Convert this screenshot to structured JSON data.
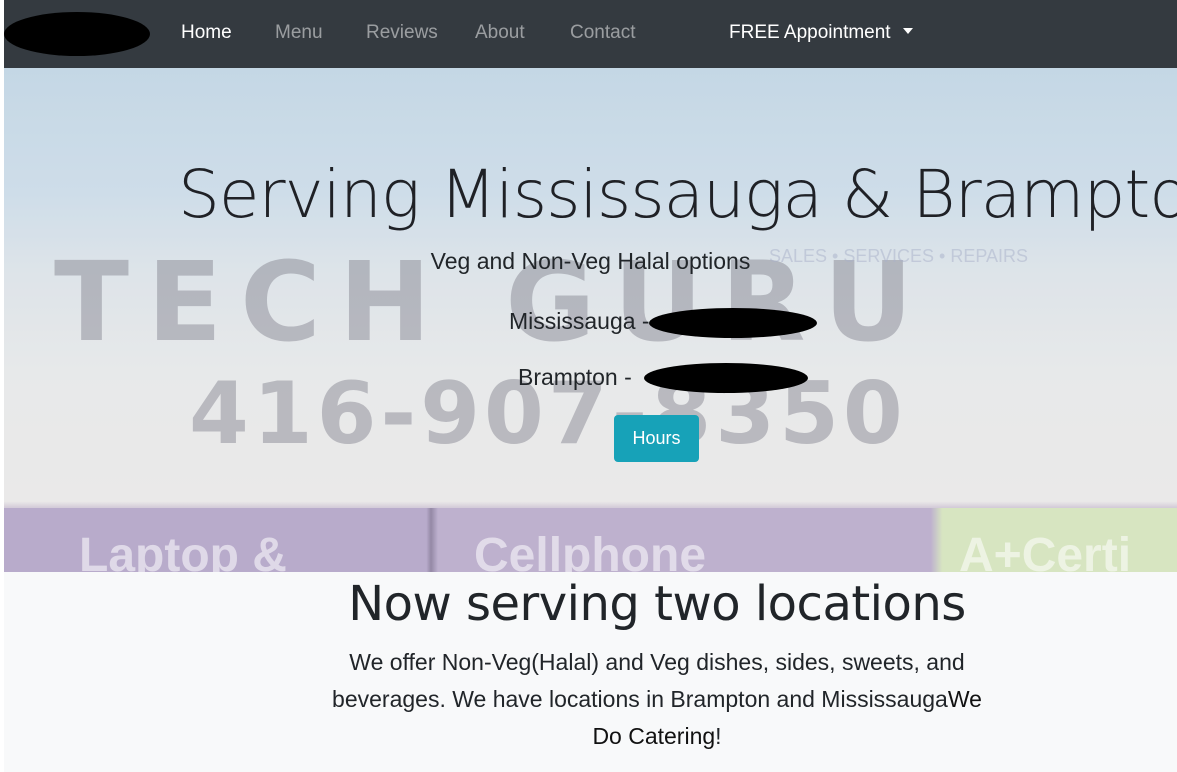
{
  "nav": {
    "items": [
      {
        "label": "Home",
        "active": true
      },
      {
        "label": "Menu",
        "active": false
      },
      {
        "label": "Reviews",
        "active": false
      },
      {
        "label": "About",
        "active": false
      },
      {
        "label": "Contact",
        "active": false
      }
    ],
    "dropdown_label": "FREE Appointment"
  },
  "hero": {
    "background_sign": {
      "line1": "TECH GURU",
      "line2": "416-907-8350",
      "tagline": "SALES • SERVICES • REPAIRS",
      "strip_left": "Laptop &",
      "strip_mid": "Cellphone",
      "strip_right": "A+Certi"
    },
    "title": "Serving Mississauga & Brampton",
    "subtitle": "Veg and Non-Veg Halal options",
    "location1_label": "Mississauga -",
    "location2_label": "Brampton -",
    "hours_button": "Hours"
  },
  "info": {
    "title": "Now serving two locations",
    "text_main": "We offer Non-Veg(Halal) and Veg dishes, sides, sweets, and beverages. We have locations in Brampton and Mississauga",
    "text_bold": "We Do Catering",
    "text_end": "!"
  },
  "colors": {
    "navbar": "#343a40",
    "hours_button": "#17a2b8",
    "info_background": "#f8f9fa"
  }
}
